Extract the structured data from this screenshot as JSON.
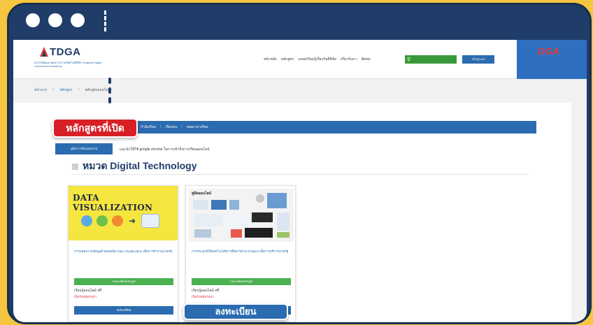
{
  "browser": {
    "window_dots": 3
  },
  "site": {
    "logo": "TDGA",
    "logo_subtitle": "สถาบันพัฒนาบุคลากรภาครัฐด้านดิจิทัล Thailand Digital Government Academy",
    "dga_logo": "DGA",
    "nav": [
      "หน้าหลัก",
      "หลักสูตร",
      "แหล่งเรียนรู้เกี่ยวกับดิจิทัล",
      "เกี่ยวกับเรา",
      "ติดต่อ"
    ],
    "login_label": "เข้าสู่ระบบ",
    "breadcrumbs": [
      "หน้าแรก",
      "หลักสูตร",
      "หลักสูตรออนไลน์"
    ]
  },
  "tabs": {
    "callout": "หลักสูตรที่เปิด",
    "items": [
      "กำลังเรียน",
      "เรียนจบ",
      "หมดเวลาเรียน"
    ]
  },
  "filter": {
    "button": "คู่มือการเรียนออนไลน์",
    "info": "แนะนำให้ใช้ google chrome ในการเข้าถึงการเรียนออนไลน์"
  },
  "category": {
    "title": "หมวด Digital Technology"
  },
  "courses": [
    {
      "thumb_title": "DATA VISUALIZATION",
      "description": "การแสดงภาพข้อมูลด้วยเทคนิค Data Visualization เพื่อการทำงานภาครัฐ",
      "detail_button": "รายละเอียดหลักสูตร",
      "price": "เรียนรู้ออนไลน์ ฟรี",
      "status": "เปิดรับสมัครแล้ว",
      "register": "ลงทะเบียน"
    },
    {
      "thumb_title": "คู่มือออนไลน์",
      "description": "การประยุกต์ใช้เทคโนโลยีการสื่อสารผ่าน Chatbot เพื่อการบริการภาครัฐ",
      "detail_button": "รายละเอียดหลักสูตร",
      "price": "เรียนรู้ออนไลน์ ฟรี",
      "status": "เปิดรับสมัครแล้ว",
      "register": "ลงทะเบียน"
    }
  ],
  "register_callout": "ลงทะเบียน",
  "colors": {
    "background": "#f6c640",
    "frame": "#1f3d68",
    "primary": "#2b6cb0",
    "callout_red": "#d81f26",
    "green": "#4caf50"
  }
}
